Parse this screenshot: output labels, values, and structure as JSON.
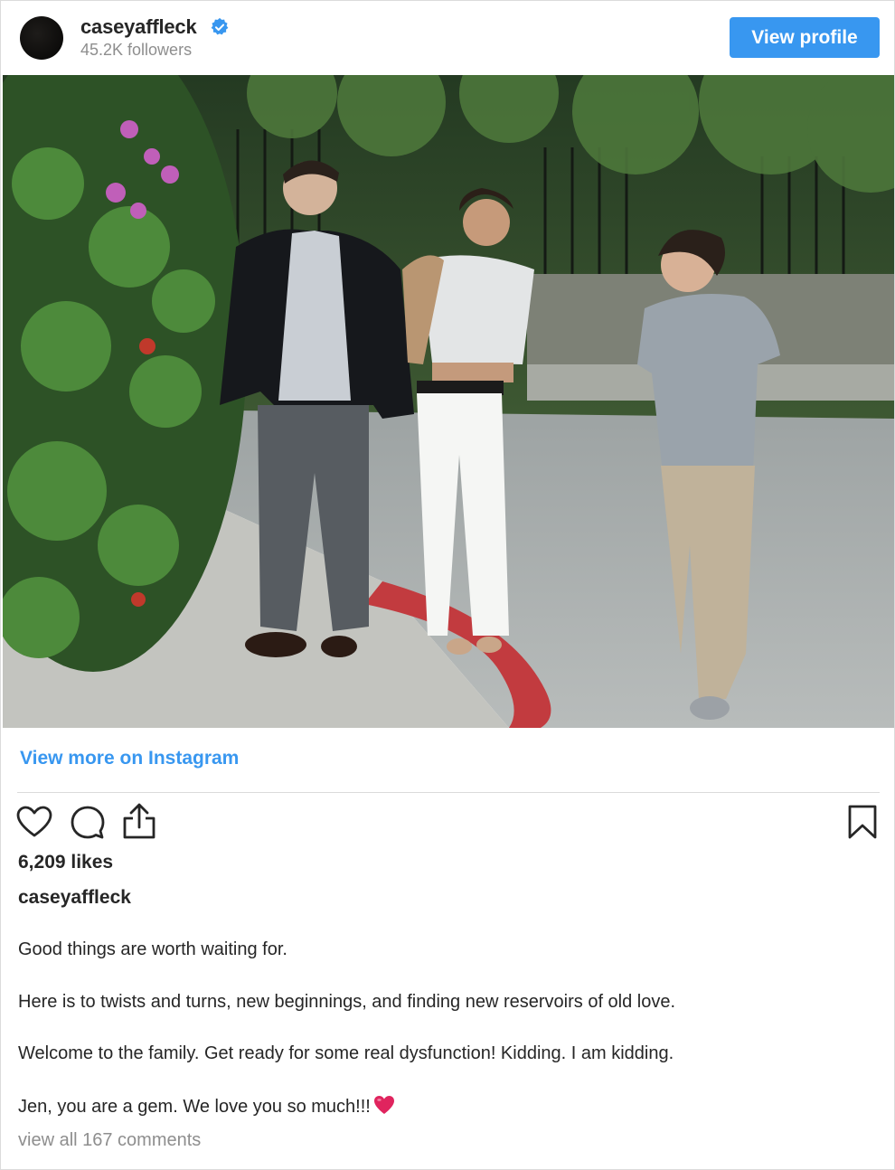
{
  "header": {
    "username": "caseyaffleck",
    "followers": "45.2K followers",
    "view_profile_label": "View profile"
  },
  "view_more_label": "View more on Instagram",
  "actions": {
    "icons": [
      "heart-icon",
      "comment-icon",
      "share-icon",
      "bookmark-icon"
    ]
  },
  "likes": "6,209 likes",
  "caption": {
    "username": "caseyaffleck",
    "lines": [
      "Good things are worth waiting for.",
      "Here is to twists and turns, new beginnings, and finding new reservoirs of old love.",
      "Welcome to the family. Get ready for some real dysfunction! Kidding. I am kidding.",
      "Jen, you are a gem. We love you so much!!!"
    ],
    "emoji": "red-heart"
  },
  "view_comments": "view all 167 comments",
  "colors": {
    "accent": "#3897f0",
    "text": "#262626",
    "muted": "#8e8e8e",
    "divider": "#dbdbdb",
    "heart": "#e0245e"
  }
}
